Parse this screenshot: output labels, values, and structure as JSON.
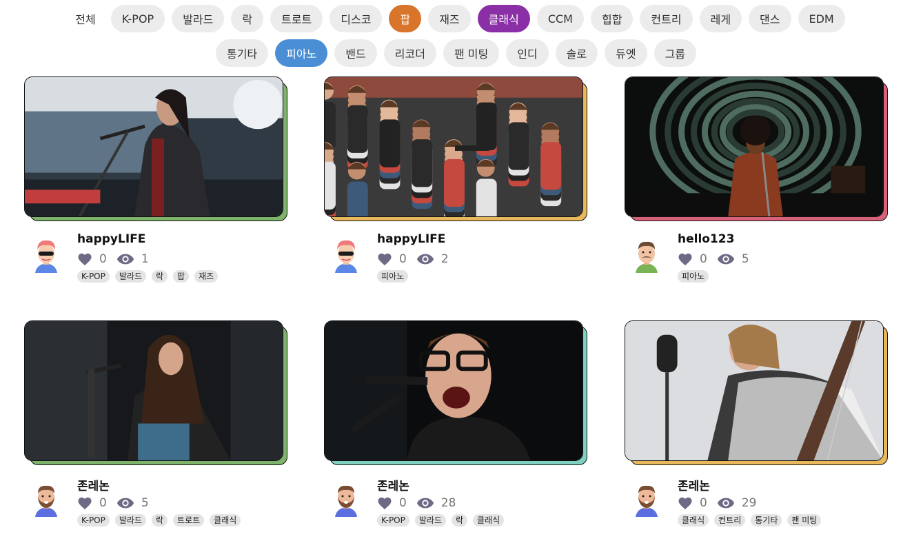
{
  "filters": {
    "row1": [
      "전체",
      "K-POP",
      "발라드",
      "락",
      "트로트",
      "디스코",
      "팝",
      "재즈",
      "클래식",
      "CCM",
      "힙합",
      "컨트리",
      "레게",
      "댄스",
      "EDM"
    ],
    "row2": [
      "통기타",
      "피아노",
      "밴드",
      "리코더",
      "팬 미팅",
      "인디",
      "솔로",
      "듀엣",
      "그룹"
    ],
    "selected_colors": {
      "팝": "#d9742b",
      "클래식": "#8a2fa5",
      "피아노": "#4a8fd6"
    }
  },
  "cards": [
    {
      "user": "happyLIFE",
      "likes": "0",
      "views": "1",
      "tags": [
        "K-POP",
        "발라드",
        "락",
        "팝",
        "재즈"
      ],
      "accent": "#7db36a",
      "avatar": "pink-hair-sunglasses",
      "image": "female singer with guitar at microphone"
    },
    {
      "user": "happyLIFE",
      "likes": "0",
      "views": "2",
      "tags": [
        "피아노"
      ],
      "accent": "#e8b85a",
      "avatar": "pink-hair-sunglasses",
      "image": "cheering concert crowd"
    },
    {
      "user": "hello123",
      "likes": "0",
      "views": "5",
      "tags": [
        "피아노"
      ],
      "accent": "#d9607a",
      "avatar": "mustache-man",
      "image": "singer on stage with spiral background"
    },
    {
      "user": "존레논",
      "likes": "0",
      "views": "5",
      "tags": [
        "K-POP",
        "발라드",
        "락",
        "트로트",
        "클래식"
      ],
      "accent": "#7db36a",
      "avatar": "bearded-man",
      "image": "female singer with long hair at microphone"
    },
    {
      "user": "존레논",
      "likes": "0",
      "views": "28",
      "tags": [
        "K-POP",
        "발라드",
        "락",
        "클래식"
      ],
      "accent": "#7fd0c0",
      "avatar": "bearded-man",
      "image": "man with glasses singing into microphone"
    },
    {
      "user": "존레논",
      "likes": "0",
      "views": "29",
      "tags": [
        "클래식",
        "컨트리",
        "통기타",
        "팬 미팅"
      ],
      "accent": "#e8b85a",
      "avatar": "bearded-man",
      "image": "woman playing guitar near studio microphone"
    }
  ]
}
